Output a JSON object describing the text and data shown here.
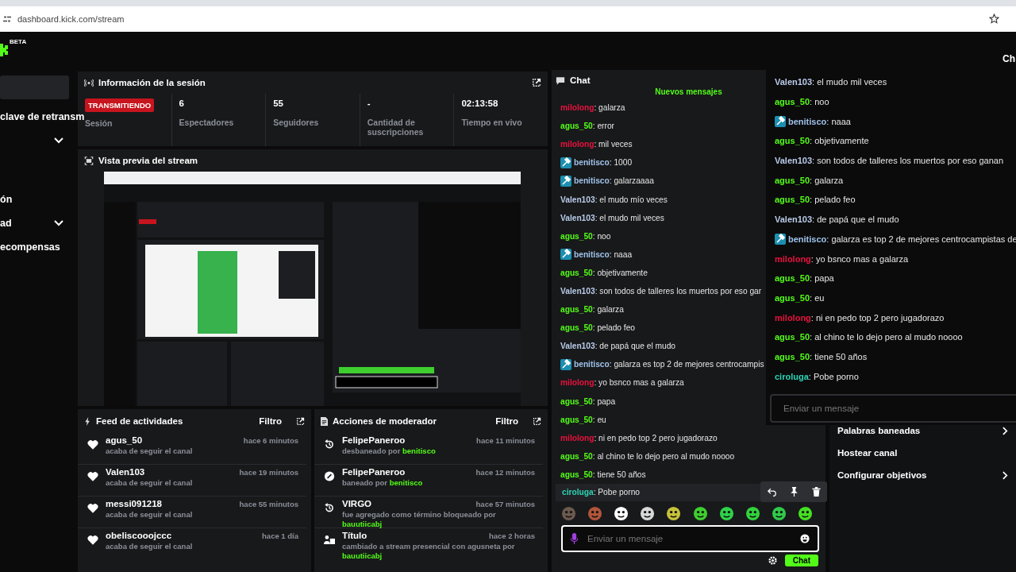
{
  "browser": {
    "url": "dashboard.kick.com/stream"
  },
  "header": {
    "logo_badge": "BETA",
    "cut_text": "Ch"
  },
  "sidebar": {
    "items": [
      {
        "label": "clave de retransm",
        "expandable": false
      },
      {
        "expandable": true
      },
      {
        "label": "ón",
        "expandable": false
      },
      {
        "label": "ad",
        "expandable": true
      },
      {
        "label": "ecompensas",
        "expandable": false
      }
    ]
  },
  "session": {
    "title": "Información de la sesión",
    "stats": [
      {
        "kind": "badge",
        "value": "TRANSMITIENDO",
        "label": "Sesión"
      },
      {
        "kind": "number",
        "value": "6",
        "label": "Espectadores"
      },
      {
        "kind": "number",
        "value": "55",
        "label": "Seguidores"
      },
      {
        "kind": "number",
        "value": "-",
        "label": "Cantidad de suscripciones"
      },
      {
        "kind": "number",
        "value": "02:13:58",
        "label": "Tiempo en vivo"
      }
    ]
  },
  "preview": {
    "title": "Vista previa del stream"
  },
  "activity_feed": {
    "title": "Feed de actividades",
    "filter": "Filtro",
    "items": [
      {
        "name": "agus_50",
        "time": "hace 6 minutos",
        "text": "acaba de seguir el canal"
      },
      {
        "name": "Valen103",
        "time": "hace 19 minutos",
        "text": "acaba de seguir el canal"
      },
      {
        "name": "messi091218",
        "time": "hace 55 minutos",
        "text": "acaba de seguir el canal"
      },
      {
        "name": "obeliscooojccc",
        "time": "hace 1 día",
        "text": "acaba de seguir el canal"
      }
    ]
  },
  "mod_actions": {
    "title": "Acciones de moderador",
    "filter": "Filtro",
    "items": [
      {
        "kind": "unban",
        "name": "FelipePaneroo",
        "time": "hace 11 minutos",
        "text": "desbaneado por",
        "actor": "benitisco"
      },
      {
        "kind": "ban",
        "name": "FelipePaneroo",
        "time": "hace 12 minutos",
        "text": "baneado por",
        "actor": "benitisco"
      },
      {
        "kind": "unban",
        "name": "VIRGO",
        "time": "hace 57 minutos",
        "text": "fue agregado como término bloqueado por",
        "actor": "bauutiicabj"
      },
      {
        "kind": "title",
        "name": "Título",
        "time": "hace 2 horas",
        "text": "cambiado a **stream presencial con agusneta** por",
        "actor": "bauutiicabj"
      }
    ]
  },
  "chat": {
    "title": "Chat",
    "new_messages": "Nuevos mensajes",
    "messages": [
      {
        "user": "milolong",
        "color": "#e8123c",
        "moderator": false,
        "text": ": galarza",
        "hovered": false
      },
      {
        "user": "agus_50",
        "color": "#53fc18",
        "moderator": false,
        "text": ": error",
        "hovered": false
      },
      {
        "user": "milolong",
        "color": "#e8123c",
        "moderator": false,
        "text": ": mil veces",
        "hovered": false
      },
      {
        "user": "benitisco",
        "color": "#9fc2ea",
        "moderator": true,
        "text": ": 1000",
        "hovered": false
      },
      {
        "user": "benitisco",
        "color": "#9fc2ea",
        "moderator": true,
        "text": ": galarzaaaa",
        "hovered": false
      },
      {
        "user": "Valen103",
        "color": "#b9cbe8",
        "moderator": false,
        "text": ": el mudo mío veces",
        "hovered": false
      },
      {
        "user": "Valen103",
        "color": "#b9cbe8",
        "moderator": false,
        "text": ": el mudo mil veces",
        "hovered": false
      },
      {
        "user": "agus_50",
        "color": "#53fc18",
        "moderator": false,
        "text": ": noo",
        "hovered": false
      },
      {
        "user": "benitisco",
        "color": "#9fc2ea",
        "moderator": true,
        "text": ": naaa",
        "hovered": false
      },
      {
        "user": "agus_50",
        "color": "#53fc18",
        "moderator": false,
        "text": ": objetivamente",
        "hovered": false
      },
      {
        "user": "Valen103",
        "color": "#b9cbe8",
        "moderator": false,
        "text": ": son todos de talleres los muertos por eso gar",
        "hovered": false
      },
      {
        "user": "agus_50",
        "color": "#53fc18",
        "moderator": false,
        "text": ": galarza",
        "hovered": false
      },
      {
        "user": "agus_50",
        "color": "#53fc18",
        "moderator": false,
        "text": ": pelado feo",
        "hovered": false
      },
      {
        "user": "Valen103",
        "color": "#b9cbe8",
        "moderator": false,
        "text": ": de papá que el mudo",
        "hovered": false
      },
      {
        "user": "benitisco",
        "color": "#9fc2ea",
        "moderator": true,
        "text": ": galarza es top 2 de mejores centrocampis",
        "hovered": false
      },
      {
        "user": "milolong",
        "color": "#e8123c",
        "moderator": false,
        "text": ": yo bsnco mas a galarza",
        "hovered": false
      },
      {
        "user": "agus_50",
        "color": "#53fc18",
        "moderator": false,
        "text": ": papa",
        "hovered": false
      },
      {
        "user": "agus_50",
        "color": "#53fc18",
        "moderator": false,
        "text": ": eu",
        "hovered": false
      },
      {
        "user": "milolong",
        "color": "#e8123c",
        "moderator": false,
        "text": ": ni en pedo top 2 pero jugadorazo",
        "hovered": false
      },
      {
        "user": "agus_50",
        "color": "#53fc18",
        "moderator": false,
        "text": ": al chino te lo dejo pero al mudo noooo",
        "hovered": false
      },
      {
        "user": "agus_50",
        "color": "#53fc18",
        "moderator": false,
        "text": ": tiene 50 años",
        "hovered": false
      },
      {
        "user": "ciroluga",
        "color": "#2bd4b4",
        "moderator": false,
        "text": ": Pobe porno",
        "hovered": true
      }
    ],
    "input": {
      "placeholder": "Enviar un mensaje"
    },
    "send": "Chat"
  },
  "settings_menu": {
    "items": [
      {
        "label": "Palabras baneadas",
        "submenu": true
      },
      {
        "label": "Hostear canal",
        "submenu": false
      },
      {
        "label": "Configurar objetivos",
        "submenu": true
      }
    ]
  },
  "popout_chat": {
    "messages": [
      {
        "user": "Valen103",
        "color": "#b9cbe8",
        "moderator": false,
        "text": ": el mudo mil veces"
      },
      {
        "user": "agus_50",
        "color": "#53fc18",
        "moderator": false,
        "text": ": noo"
      },
      {
        "user": "benitisco",
        "color": "#9fc2ea",
        "moderator": true,
        "text": ": naaa"
      },
      {
        "user": "agus_50",
        "color": "#53fc18",
        "moderator": false,
        "text": ": objetivamente"
      },
      {
        "user": "Valen103",
        "color": "#b9cbe8",
        "moderator": false,
        "text": ": son todos de talleres los muertos por eso ganan"
      },
      {
        "user": "agus_50",
        "color": "#53fc18",
        "moderator": false,
        "text": ": galarza"
      },
      {
        "user": "agus_50",
        "color": "#53fc18",
        "moderator": false,
        "text": ": pelado feo"
      },
      {
        "user": "Valen103",
        "color": "#b9cbe8",
        "moderator": false,
        "text": ": de papá que el mudo"
      },
      {
        "user": "benitisco",
        "color": "#9fc2ea",
        "moderator": true,
        "text": ": galarza es top 2 de mejores centrocampistas de"
      },
      {
        "user": "milolong",
        "color": "#e8123c",
        "moderator": false,
        "text": ": yo bsnco mas a galarza"
      },
      {
        "user": "agus_50",
        "color": "#53fc18",
        "moderator": false,
        "text": ": papa"
      },
      {
        "user": "agus_50",
        "color": "#53fc18",
        "moderator": false,
        "text": ": eu"
      },
      {
        "user": "milolong",
        "color": "#e8123c",
        "moderator": false,
        "text": ": ni en pedo top 2 pero jugadorazo"
      },
      {
        "user": "agus_50",
        "color": "#53fc18",
        "moderator": false,
        "text": ": al chino te lo dejo pero al mudo noooo"
      },
      {
        "user": "agus_50",
        "color": "#53fc18",
        "moderator": false,
        "text": ": tiene 50 años"
      },
      {
        "user": "ciroluga",
        "color": "#2bd4b4",
        "moderator": false,
        "text": ": Pobe porno"
      }
    ],
    "input": {
      "placeholder": "Enviar un mensaje"
    }
  }
}
